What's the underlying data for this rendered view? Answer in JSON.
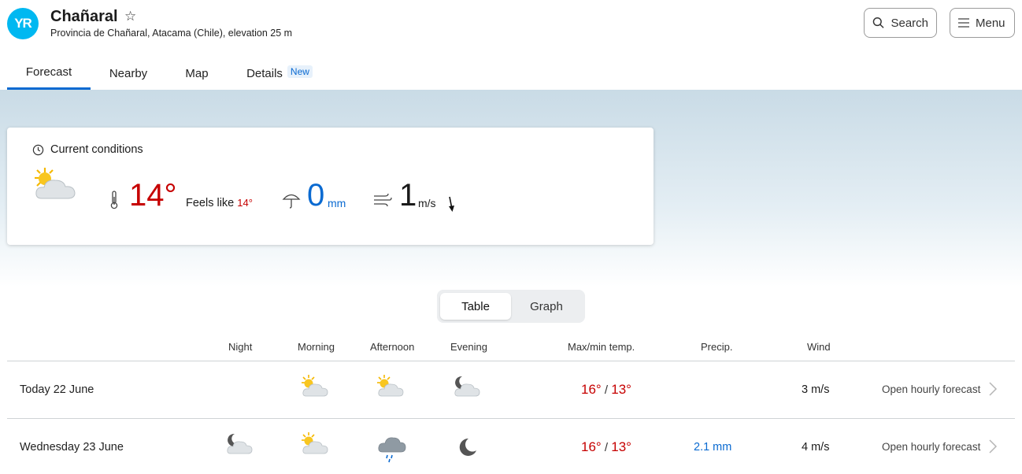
{
  "header": {
    "logo_text": "YR",
    "place_name": "Chañaral",
    "place_sub": "Provincia de Chañaral, Atacama (Chile), elevation 25 m",
    "search_label": "Search",
    "menu_label": "Menu"
  },
  "tabs": [
    {
      "label": "Forecast",
      "active": true
    },
    {
      "label": "Nearby"
    },
    {
      "label": "Map"
    },
    {
      "label": "Details",
      "badge": "New"
    }
  ],
  "current": {
    "title": "Current conditions",
    "temperature": "14°",
    "feels_like_label": "Feels like",
    "feels_like_value": "14°",
    "precip_value": "0",
    "precip_unit": "mm",
    "wind_value": "1",
    "wind_unit": "m/s",
    "weather_icon": "partly-cloudy-day-icon"
  },
  "view_toggle": {
    "table": "Table",
    "graph": "Graph",
    "selected": "Table"
  },
  "table": {
    "headers": {
      "night": "Night",
      "morning": "Morning",
      "afternoon": "Afternoon",
      "evening": "Evening",
      "maxmin": "Max/min temp.",
      "precip": "Precip.",
      "wind": "Wind"
    },
    "rows": [
      {
        "day": "Today 22 June",
        "night": "",
        "morning": "partly-cloudy-day-icon",
        "afternoon": "partly-cloudy-day-icon",
        "evening": "partly-cloudy-night-icon",
        "max": "16°",
        "min": "13°",
        "precip": "",
        "wind": "3 m/s",
        "link": "Open hourly forecast"
      },
      {
        "day": "Wednesday 23 June",
        "night": "partly-cloudy-night-icon",
        "morning": "partly-cloudy-day-icon",
        "afternoon": "rain-cloud-icon",
        "evening": "clear-night-icon",
        "max": "16°",
        "min": "13°",
        "precip": "2.1 mm",
        "wind": "4 m/s",
        "link": "Open hourly forecast"
      }
    ]
  },
  "colors": {
    "accent": "#0a6ad1",
    "warm": "#c60000",
    "logo": "#00b8f1"
  }
}
